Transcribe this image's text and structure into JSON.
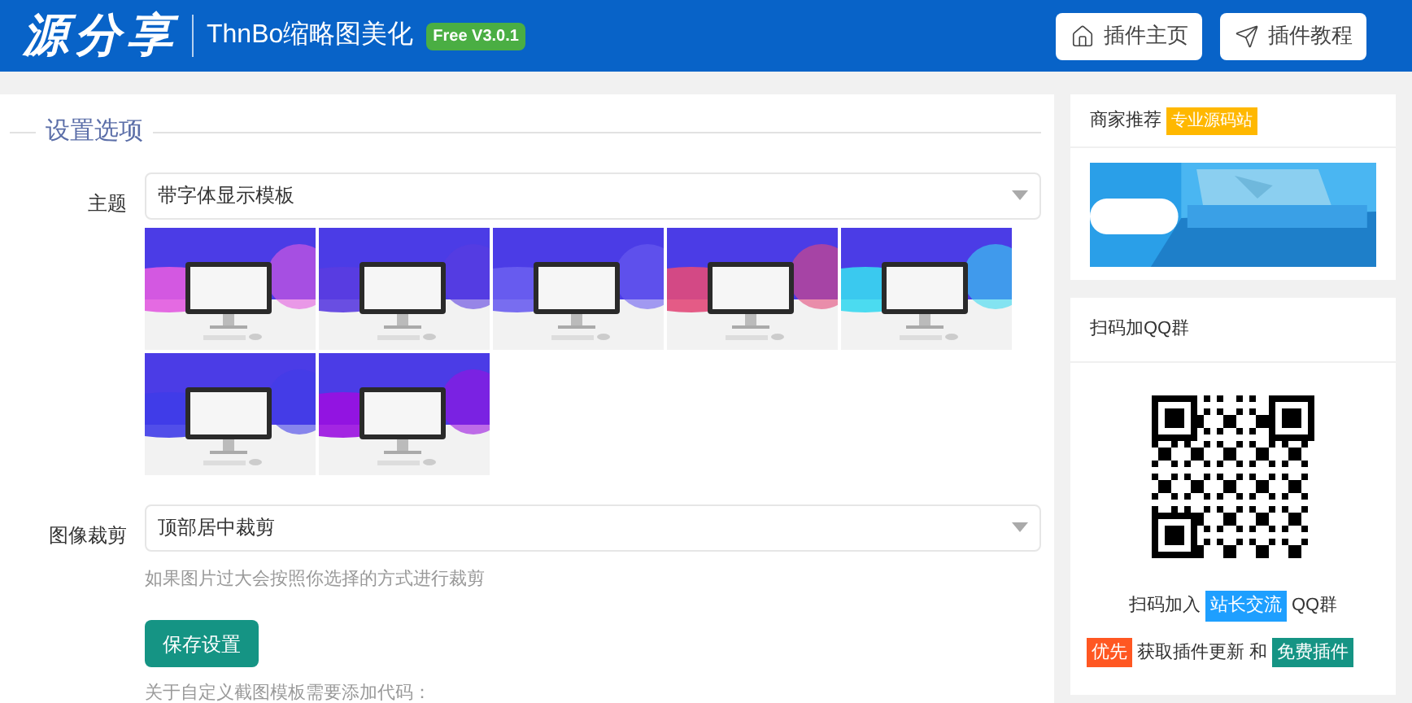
{
  "header": {
    "logo": "源分享",
    "title": "ThnBo缩略图美化",
    "version_badge": "Free V3.0.1",
    "buttons": [
      {
        "label": "插件主页",
        "kind": "home"
      },
      {
        "label": "插件教程",
        "kind": "send"
      }
    ]
  },
  "settings": {
    "legend": "设置选项",
    "theme": {
      "label": "主题",
      "value": "带字体显示模板"
    },
    "crop": {
      "label": "图像裁剪",
      "value": "顶部居中裁剪",
      "hint": "如果图片过大会按照你选择的方式进行裁剪"
    },
    "save_button": "保存设置",
    "note": "关于自定义截图模板需要添加代码："
  },
  "sidebar": {
    "recommend": {
      "title": "商家推荐",
      "badge": "专业源码站"
    },
    "qq": {
      "title": "扫码加QQ群",
      "join_prefix": "扫码加入",
      "join_badge": "站长交流",
      "join_suffix": "QQ群",
      "priority_badge": "优先",
      "priority_text": "获取插件更新 和",
      "free_badge": "免费插件"
    }
  }
}
